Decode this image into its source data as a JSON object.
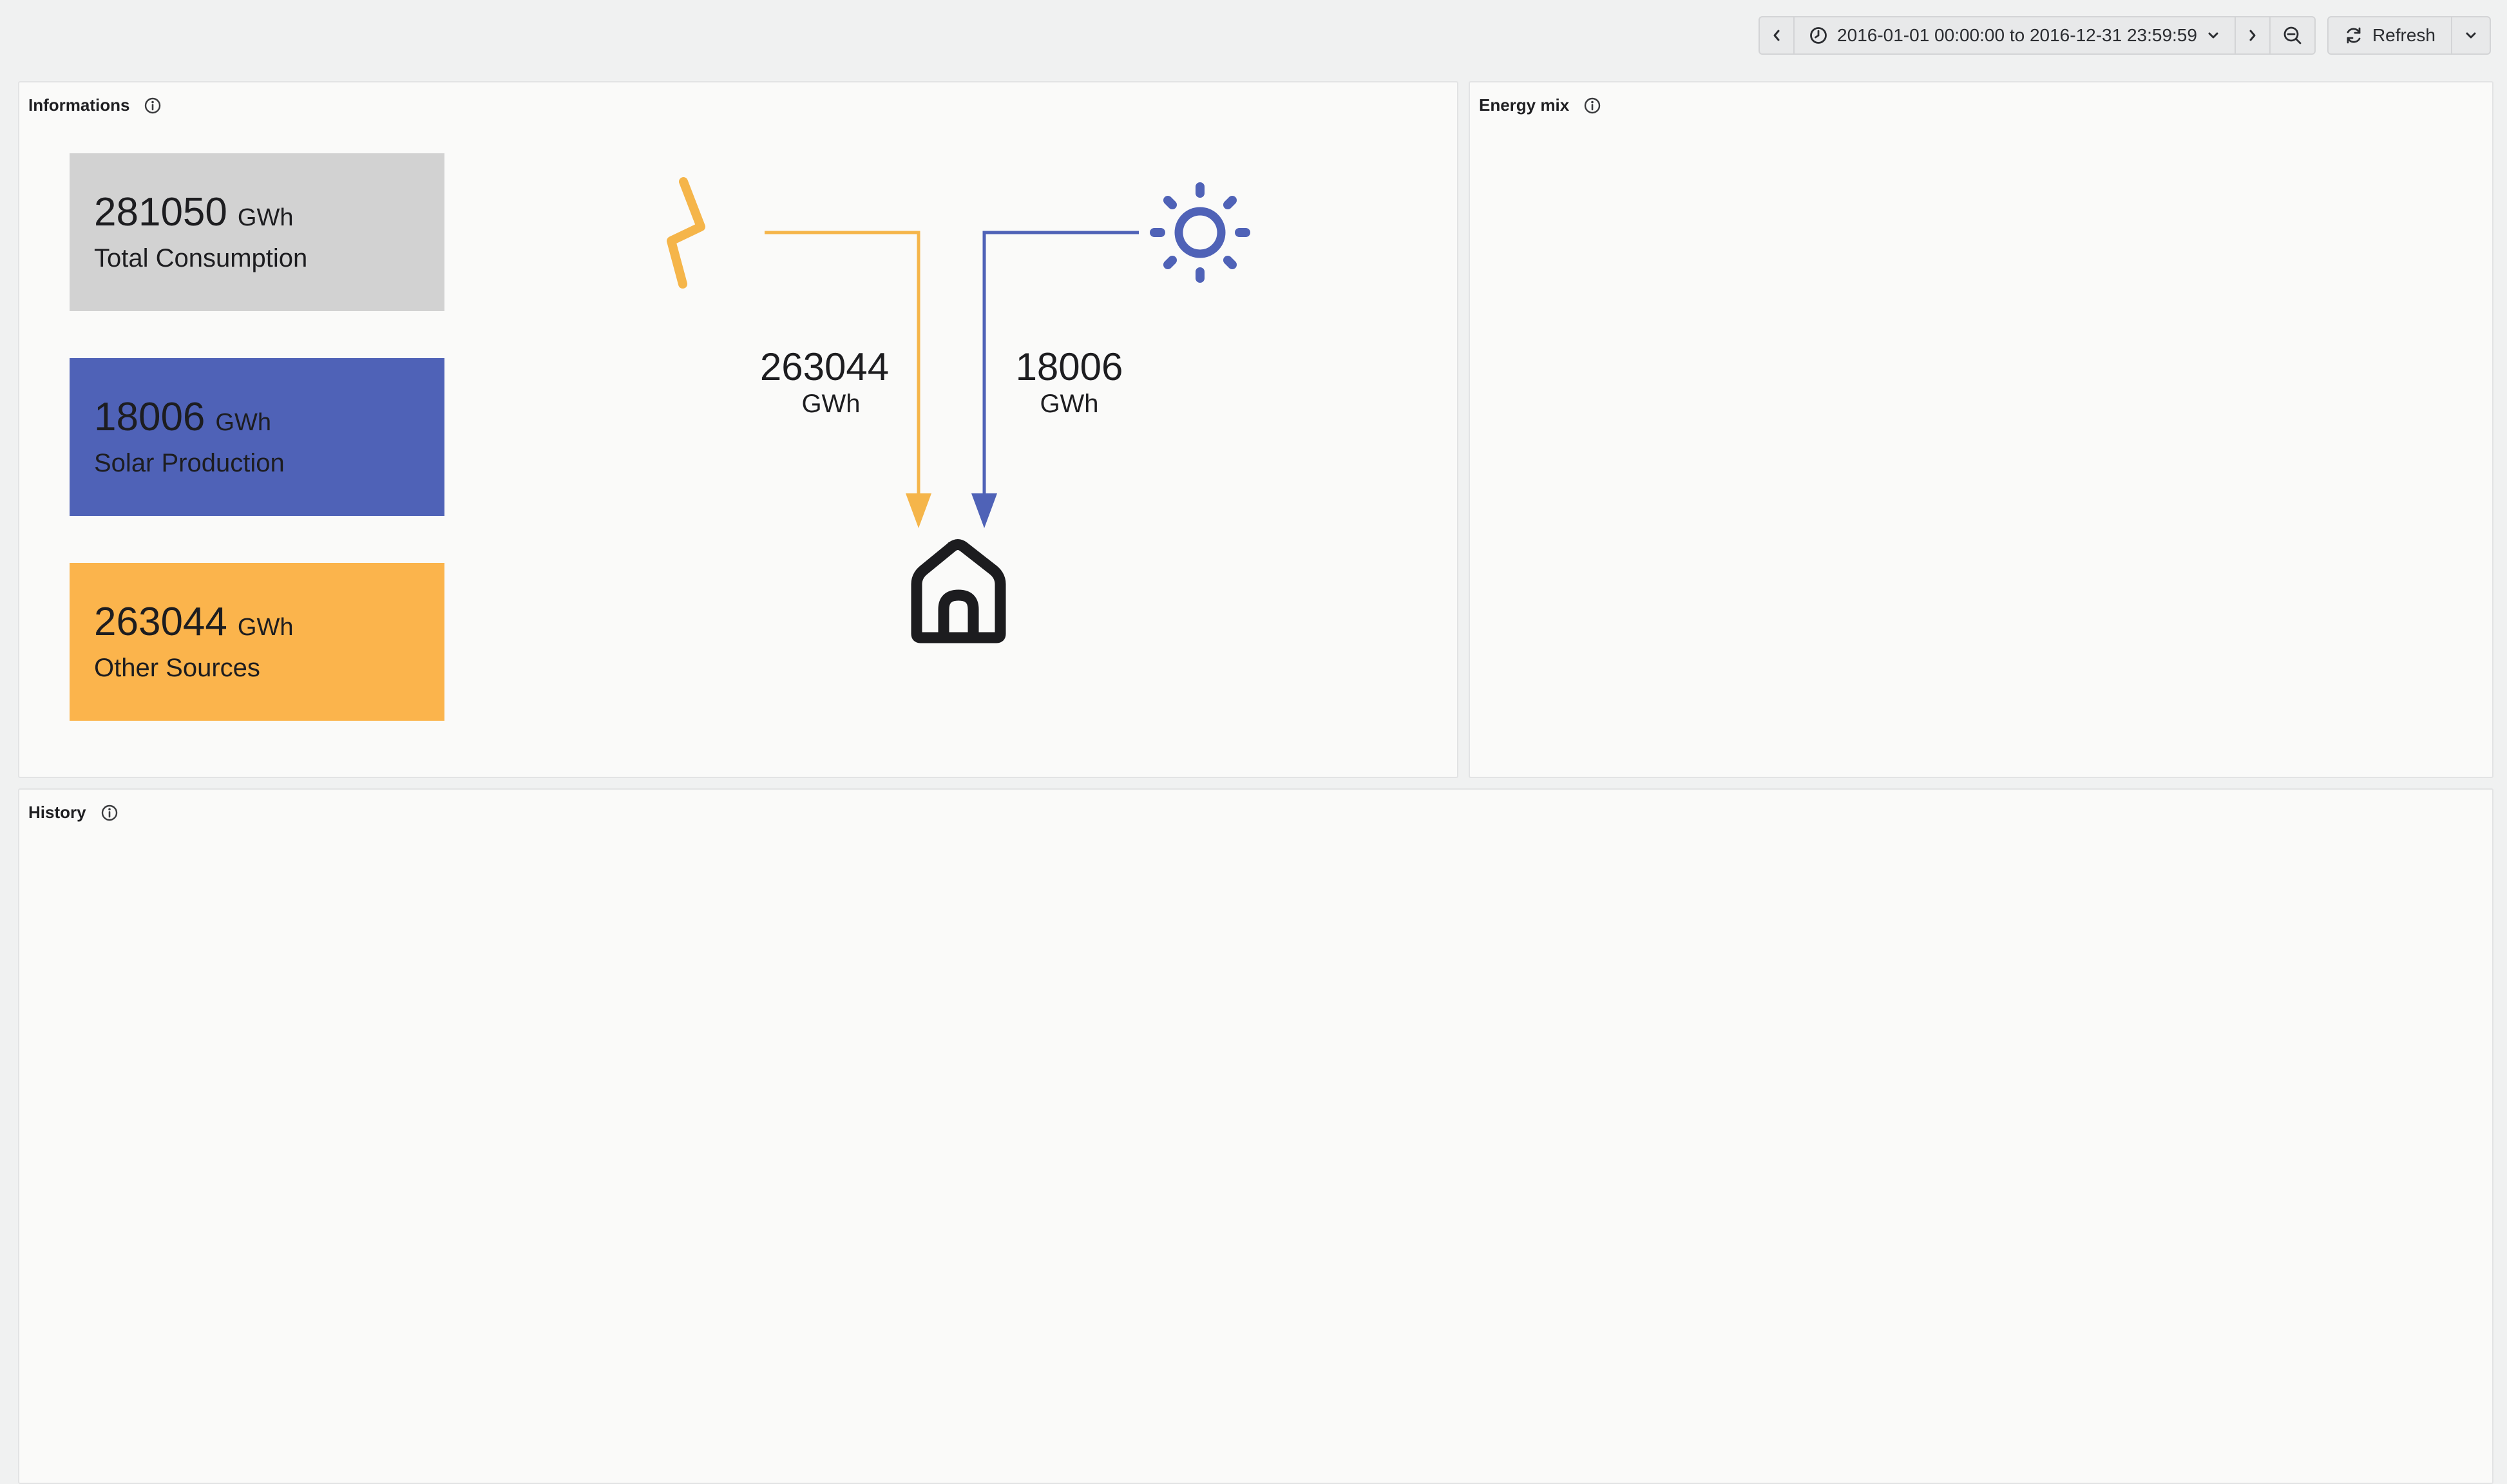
{
  "toolbar": {
    "prev_icon": "chevron-left-icon",
    "time_range": "2016-01-01 00:00:00 to 2016-12-31 23:59:59",
    "clock_icon": "clock-icon",
    "range_dropdown_icon": "chevron-down-icon",
    "next_icon": "chevron-right-icon",
    "zoom_out_icon": "zoom-out-icon",
    "refresh_label": "Refresh",
    "refresh_icon": "refresh-icon",
    "refresh_dropdown_icon": "chevron-down-icon"
  },
  "panels": {
    "informations": {
      "title": "Informations",
      "info_icon": "info-icon"
    },
    "energy_mix": {
      "title": "Energy mix",
      "info_icon": "info-icon"
    },
    "history": {
      "title": "History",
      "info_icon": "info-icon"
    }
  },
  "stats": [
    {
      "value": "281050",
      "unit": "GWh",
      "label": "Total Consumption",
      "color": "#d2d2d2"
    },
    {
      "value": "18006",
      "unit": "GWh",
      "label": "Solar Production",
      "color": "#4f62b7"
    },
    {
      "value": "263044",
      "unit": "GWh",
      "label": "Other Sources",
      "color": "#fbb44c"
    }
  ],
  "flow": {
    "grid_icon": "lightning-icon",
    "solar_icon": "sun-icon",
    "home_icon": "home-icon",
    "grid_value": "263044",
    "grid_unit": "GWh",
    "solar_value": "18006",
    "solar_unit": "GWh",
    "grid_color": "#f5b54a",
    "solar_color": "#4f62b7"
  },
  "colors": {
    "background": "#f0f1f1",
    "panel": "#fafaf9"
  }
}
